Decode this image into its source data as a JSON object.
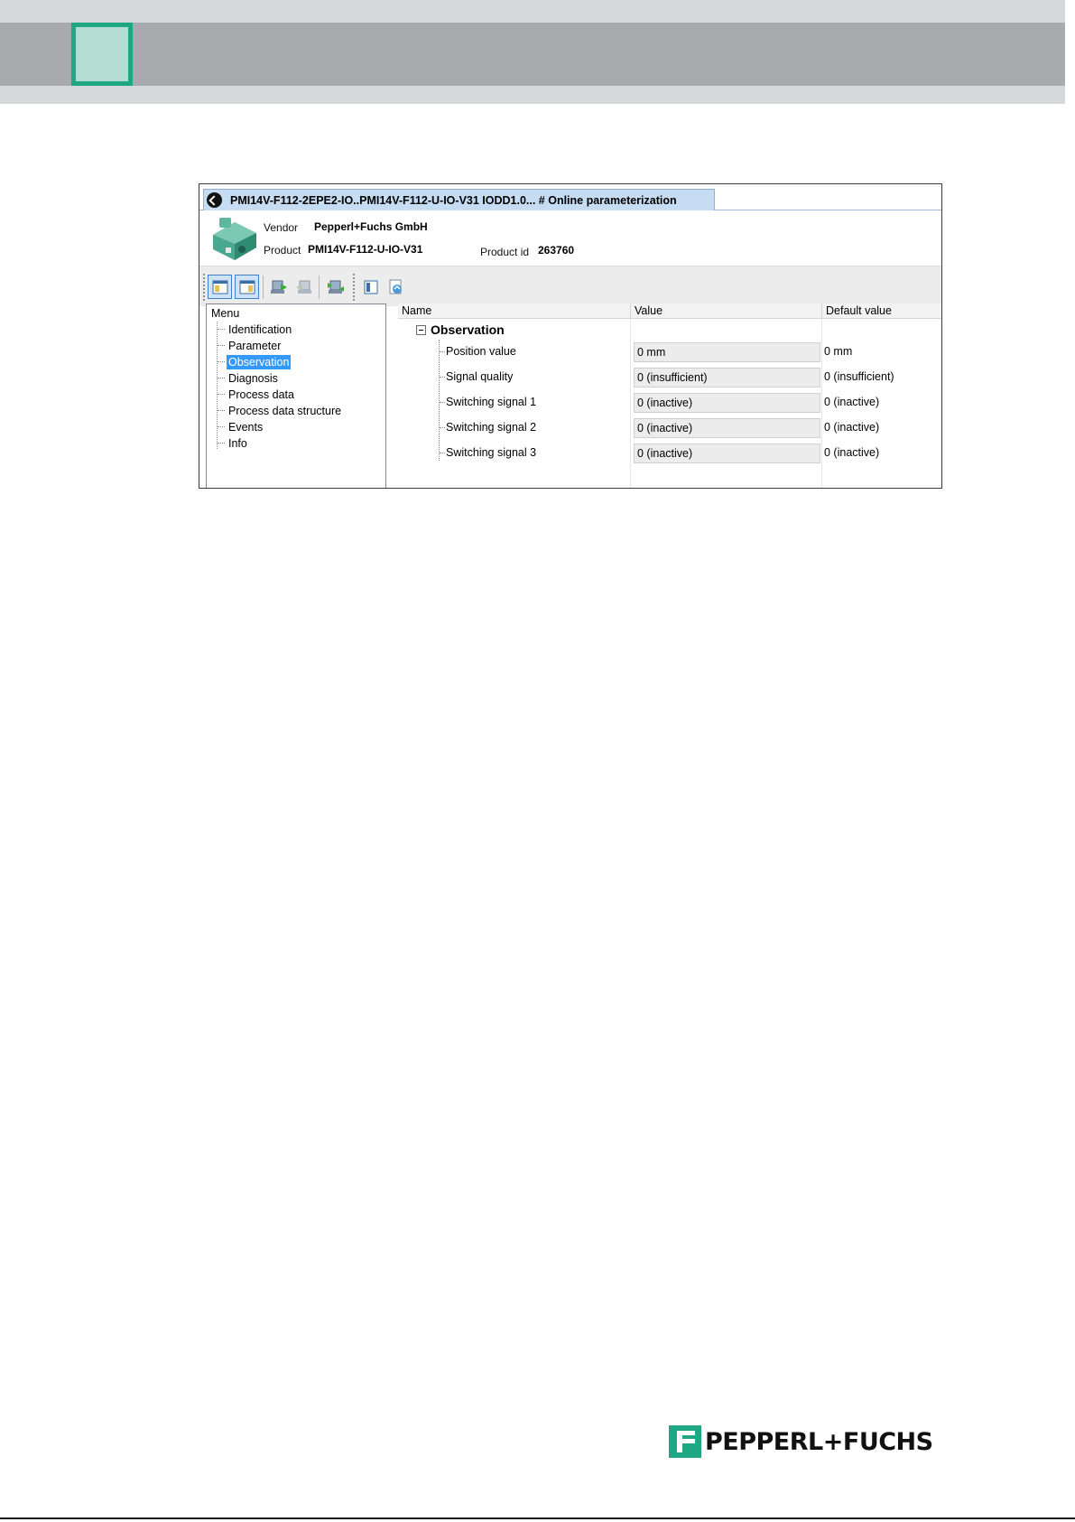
{
  "window": {
    "tab_title": "PMI14V-F112-2EPE2-IO..PMI14V-F112-U-IO-V31 IODD1.0... # Online parameterization"
  },
  "device": {
    "vendor_label": "Vendor",
    "vendor_value": "Pepperl+Fuchs GmbH",
    "product_label": "Product",
    "product_value": "PMI14V-F112-U-IO-V31",
    "product_id_label": "Product id",
    "product_id_value": "263760"
  },
  "toolbar": {
    "icons": [
      "view-layout-1-icon",
      "view-layout-2-icon",
      "download-to-device-icon",
      "upload-from-device-icon",
      "sync-device-icon",
      "properties-icon",
      "export-icon"
    ]
  },
  "menu": {
    "title": "Menu",
    "items": [
      {
        "label": "Identification"
      },
      {
        "label": "Parameter"
      },
      {
        "label": "Observation"
      },
      {
        "label": "Diagnosis"
      },
      {
        "label": "Process data"
      },
      {
        "label": "Process data structure"
      },
      {
        "label": "Events"
      },
      {
        "label": "Info"
      }
    ],
    "selected": "Observation"
  },
  "grid": {
    "columns": [
      "Name",
      "Value",
      "Default value"
    ],
    "group": "Observation",
    "rows": [
      {
        "name": "Position value",
        "value": "0 mm",
        "default": "0 mm"
      },
      {
        "name": "Signal quality",
        "value": "0 (insufficient)",
        "default": "0 (insufficient)"
      },
      {
        "name": "Switching signal 1",
        "value": "0 (inactive)",
        "default": "0 (inactive)"
      },
      {
        "name": "Switching signal 2",
        "value": "0 (inactive)",
        "default": "0 (inactive)"
      },
      {
        "name": "Switching signal 3",
        "value": "0 (inactive)",
        "default": "0 (inactive)"
      }
    ]
  },
  "logo": {
    "text": "PEPPERL+FUCHS"
  },
  "colors": {
    "brand_green": "#1fa683",
    "chapter_square_fill": "#b3ddd3",
    "header_band": "#a8aaad",
    "selection_blue": "#3399ff",
    "tab_blue": "#c5dcf2"
  }
}
